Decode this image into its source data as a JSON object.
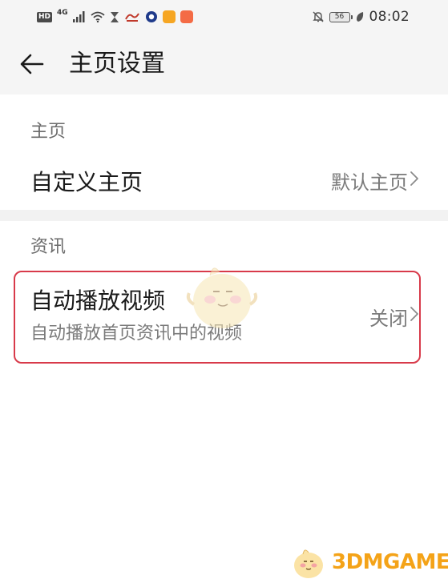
{
  "status_bar": {
    "hd_label": "HD",
    "network_label": "4G",
    "battery_level": "56",
    "time": "08:02",
    "icons": [
      "hd-icon",
      "signal-icon",
      "wifi-icon",
      "hourglass-icon",
      "app-icon",
      "circle-app-icon",
      "orange-app-icon",
      "red-app-icon",
      "bell-muted-icon",
      "battery-icon",
      "leaf-icon"
    ]
  },
  "header": {
    "title": "主页设置",
    "back_icon": "back-arrow-icon"
  },
  "sections": [
    {
      "header": "主页",
      "rows": [
        {
          "title": "自定义主页",
          "value": "默认主页"
        }
      ]
    },
    {
      "header": "资讯",
      "rows": [
        {
          "title": "自动播放视频",
          "subtitle": "自动播放首页资讯中的视频",
          "value": "关闭"
        }
      ]
    }
  ],
  "watermark": {
    "text": "3DMGAME"
  },
  "colors": {
    "highlight_border": "#d83a4a",
    "watermark": "#f4a318"
  }
}
